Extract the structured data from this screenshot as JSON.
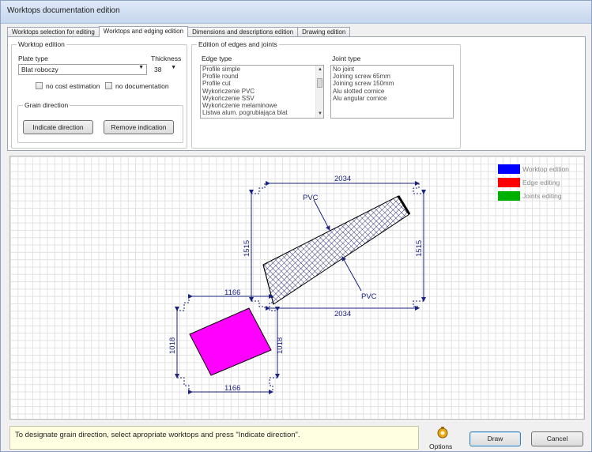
{
  "window": {
    "title": "Worktops documentation edition"
  },
  "tabs": [
    {
      "label": "Worktops selection for editing",
      "active": false
    },
    {
      "label": "Worktops and edging edition",
      "active": true
    },
    {
      "label": "Dimensions and descriptions edition",
      "active": false
    },
    {
      "label": "Drawing edition",
      "active": false
    }
  ],
  "worktop_edition": {
    "title": "Worktop edition",
    "plate_type_label": "Plate type",
    "plate_type_value": "Blat roboczy",
    "thickness_label": "Thickness",
    "thickness_value": "38",
    "no_cost_estimation": "no cost estimation",
    "no_documentation": "no documentation",
    "grain_title": "Grain direction",
    "indicate_button": "Indicate direction",
    "remove_button": "Remove indication"
  },
  "edges": {
    "title": "Edition of edges and joints",
    "edge_type_label": "Edge type",
    "edge_types": [
      "Profile simple",
      "Profile round",
      "Profile cut",
      "Wykończenie PVC",
      "Wykończenie SSV",
      "Wykończenie melaminowe",
      "Listwa alum. pogrubiająca blat"
    ],
    "joint_type_label": "Joint type",
    "joint_types": [
      "No joint",
      "Joining screw 65mm",
      "Joining screw 150mm",
      "Alu slotted cornice",
      "Alu angular cornice"
    ]
  },
  "legend": {
    "items": [
      {
        "label": "Worktop edition",
        "color": "#0000ff"
      },
      {
        "label": "Edge editing",
        "color": "#ff0000"
      },
      {
        "label": "Joints editing",
        "color": "#00b000"
      }
    ]
  },
  "drawing": {
    "dim_top": "2034",
    "dim_bottom": "2034",
    "dim_left_a": "1515",
    "dim_right_a": "1515",
    "pvc_top": "PVC",
    "pvc_bottom": "PVC",
    "dim_b_top": "1166",
    "dim_b_bottom": "1166",
    "dim_b_left": "1018",
    "dim_b_right": "1018",
    "hatch_color": "#1a1a6e",
    "magenta": "#ff00ff",
    "dim_color": "#1a237e"
  },
  "status": {
    "text": "To designate grain direction, select apropriate worktops and press \"Indicate direction\"."
  },
  "footer": {
    "options_label": "Options",
    "draw_button": "Draw",
    "cancel_button": "Cancel"
  }
}
